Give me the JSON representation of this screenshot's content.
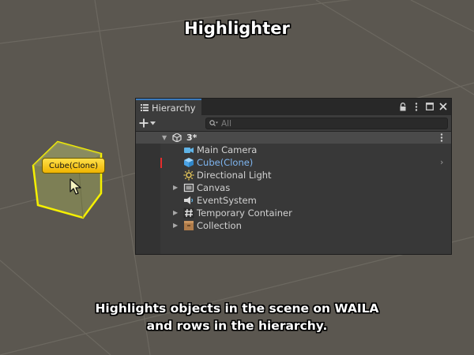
{
  "title": "Highlighter",
  "caption": {
    "line1": "Highlights objects in the scene on WAILA",
    "line2": "and rows in the hierarchy."
  },
  "scene": {
    "tooltip": "Cube(Clone)",
    "highlight_color": "#f5f000"
  },
  "hierarchy": {
    "tab_label": "Hierarchy",
    "search_placeholder": "All",
    "scene_name": "3*",
    "items": [
      {
        "label": "Main Camera",
        "icon": "camera-icon",
        "foldout": false
      },
      {
        "label": "Cube(Clone)",
        "icon": "cube-icon",
        "foldout": false,
        "highlighted": true
      },
      {
        "label": "Directional Light",
        "icon": "light-icon",
        "foldout": false
      },
      {
        "label": "Canvas",
        "icon": "canvas-icon",
        "foldout": true
      },
      {
        "label": "EventSystem",
        "icon": "event-system-icon",
        "foldout": false
      },
      {
        "label": "Temporary Container",
        "icon": "hash-icon",
        "foldout": true
      },
      {
        "label": "Collection",
        "icon": "box-icon",
        "foldout": true
      }
    ]
  },
  "colors": {
    "background": "#5b5750",
    "accent_tab": "#3a79bb",
    "highlight_text": "#7fb6f1",
    "highlight_marker": "#e62d2d"
  }
}
